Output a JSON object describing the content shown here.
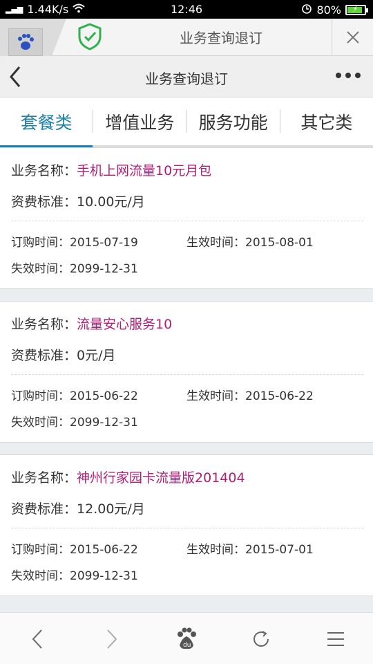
{
  "status_bar": {
    "signal": "4G",
    "speed": "1.44K/s",
    "time": "12:46",
    "battery": "80%"
  },
  "browser": {
    "title": "业务查询退订"
  },
  "header": {
    "title": "业务查询退订"
  },
  "tabs": [
    {
      "label": "套餐类",
      "active": true
    },
    {
      "label": "增值业务",
      "active": false
    },
    {
      "label": "服务功能",
      "active": false
    },
    {
      "label": "其它类",
      "active": false
    }
  ],
  "cards": [
    {
      "name_label": "业务名称：",
      "name": "手机上网流量10元月包",
      "fee_label": "资费标准：",
      "fee": "10.00元/月",
      "order_label": "订购时间：",
      "order_date": "2015-07-19",
      "effect_label": "生效时间：",
      "effect_date": "2015-08-01",
      "expire_label": "失效时间：",
      "expire_date": "2099-12-31"
    },
    {
      "name_label": "业务名称：",
      "name": "流量安心服务10",
      "fee_label": "资费标准：",
      "fee": "0元/月",
      "order_label": "订购时间：",
      "order_date": "2015-06-22",
      "effect_label": "生效时间：",
      "effect_date": "2015-06-22",
      "expire_label": "失效时间：",
      "expire_date": "2099-12-31"
    },
    {
      "name_label": "业务名称：",
      "name": "神州行家园卡流量版201404",
      "fee_label": "资费标准：",
      "fee": "12.00元/月",
      "order_label": "订购时间：",
      "order_date": "2015-06-22",
      "effect_label": "生效时间：",
      "effect_date": "2015-07-01",
      "expire_label": "失效时间：",
      "expire_date": "2099-12-31"
    }
  ],
  "colors": {
    "accent": "#1f7fae",
    "name_value": "#b01e78"
  }
}
